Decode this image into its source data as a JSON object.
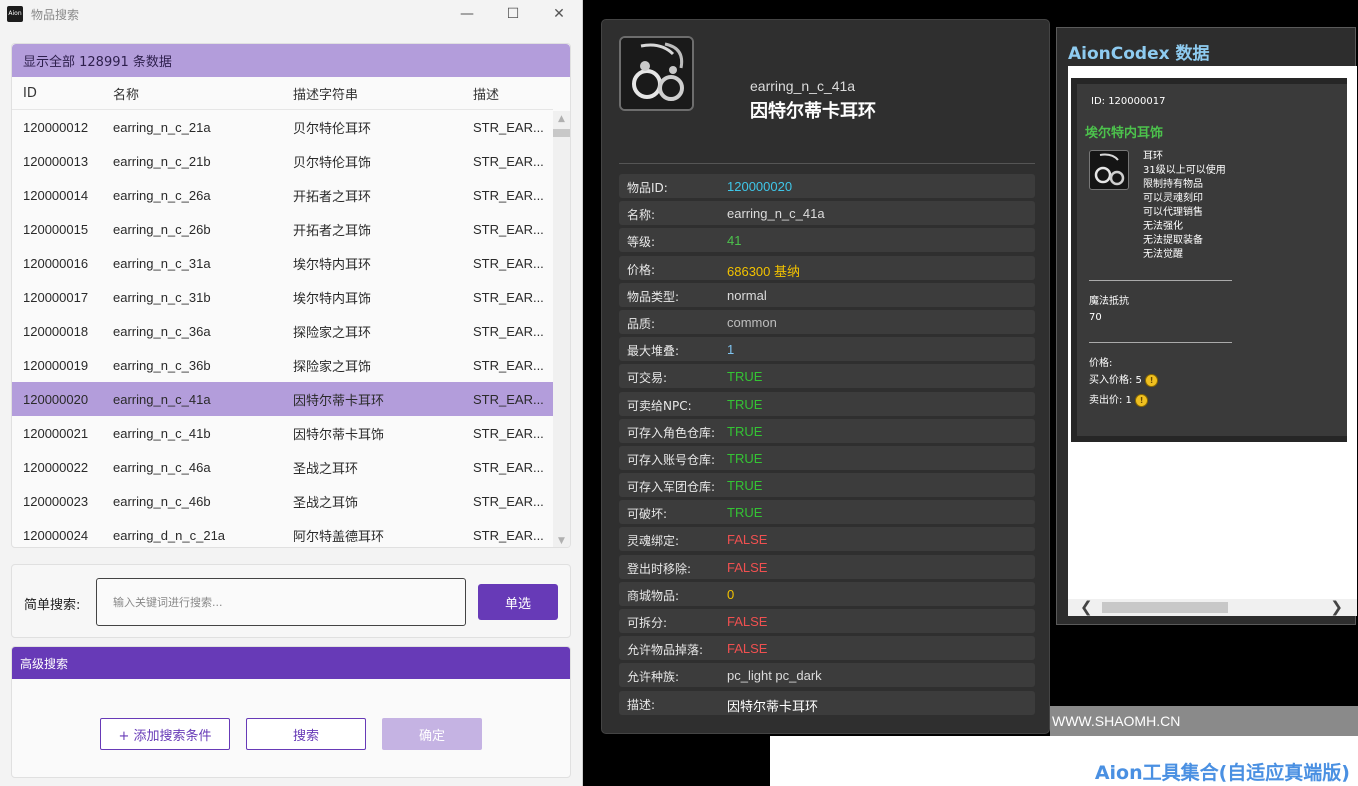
{
  "window": {
    "app_icon_text": "Aion",
    "title": "物品搜索",
    "controls": {
      "minimize": "—",
      "maximize": "☐",
      "close": "✕"
    }
  },
  "table": {
    "banner": "显示全部 128991 条数据",
    "columns": [
      "ID",
      "名称",
      "描述字符串",
      "描述"
    ],
    "rows": [
      {
        "id": "120000012",
        "name": "earring_n_c_21a",
        "desc": "贝尔特伦耳环",
        "str": "STR_EAR..."
      },
      {
        "id": "120000013",
        "name": "earring_n_c_21b",
        "desc": "贝尔特伦耳饰",
        "str": "STR_EAR..."
      },
      {
        "id": "120000014",
        "name": "earring_n_c_26a",
        "desc": "开拓者之耳环",
        "str": "STR_EAR..."
      },
      {
        "id": "120000015",
        "name": "earring_n_c_26b",
        "desc": "开拓者之耳饰",
        "str": "STR_EAR..."
      },
      {
        "id": "120000016",
        "name": "earring_n_c_31a",
        "desc": "埃尔特内耳环",
        "str": "STR_EAR..."
      },
      {
        "id": "120000017",
        "name": "earring_n_c_31b",
        "desc": "埃尔特内耳饰",
        "str": "STR_EAR..."
      },
      {
        "id": "120000018",
        "name": "earring_n_c_36a",
        "desc": "探险家之耳环",
        "str": "STR_EAR..."
      },
      {
        "id": "120000019",
        "name": "earring_n_c_36b",
        "desc": "探险家之耳饰",
        "str": "STR_EAR..."
      },
      {
        "id": "120000020",
        "name": "earring_n_c_41a",
        "desc": "因特尔蒂卡耳环",
        "str": "STR_EAR...",
        "selected": true
      },
      {
        "id": "120000021",
        "name": "earring_n_c_41b",
        "desc": "因特尔蒂卡耳饰",
        "str": "STR_EAR..."
      },
      {
        "id": "120000022",
        "name": "earring_n_c_46a",
        "desc": "圣战之耳环",
        "str": "STR_EAR..."
      },
      {
        "id": "120000023",
        "name": "earring_n_c_46b",
        "desc": "圣战之耳饰",
        "str": "STR_EAR..."
      },
      {
        "id": "120000024",
        "name": "earring_d_n_c_21a",
        "desc": "阿尔特盖德耳环",
        "str": "STR_EAR..."
      }
    ],
    "selected_row_color": "#b39ddb"
  },
  "simple_search": {
    "label": "简单搜索:",
    "placeholder": "输入关键词进行搜索...",
    "button": "单选"
  },
  "advanced_search": {
    "header": "高级搜索",
    "add_button": "+ 添加搜索条件",
    "search_button": "搜索",
    "confirm_button": "确定"
  },
  "detail": {
    "code": "earring_n_c_41a",
    "title": "因特尔蒂卡耳环",
    "properties": [
      {
        "key": "物品ID:",
        "value": "120000020",
        "color": "#3fc6e8"
      },
      {
        "key": "名称:",
        "value": "earring_n_c_41a",
        "color": "#dcdcdc"
      },
      {
        "key": "等级:",
        "value": "41",
        "color": "#4cc24c"
      },
      {
        "key": "价格:",
        "value": "686300 基纳",
        "color": "#f2c200"
      },
      {
        "key": "物品类型:",
        "value": "normal",
        "color": "#dcdcdc"
      },
      {
        "key": "品质:",
        "value": "common",
        "color": "#bdbdbd"
      },
      {
        "key": "最大堆叠:",
        "value": "1",
        "color": "#7fc4f0"
      },
      {
        "key": "可交易:",
        "value": "TRUE",
        "color": "#34c434"
      },
      {
        "key": "可卖给NPC:",
        "value": "TRUE",
        "color": "#34c434"
      },
      {
        "key": "可存入角色仓库:",
        "value": "TRUE",
        "color": "#34c434"
      },
      {
        "key": "可存入账号仓库:",
        "value": "TRUE",
        "color": "#34c434"
      },
      {
        "key": "可存入军团仓库:",
        "value": "TRUE",
        "color": "#34c434"
      },
      {
        "key": "可破坏:",
        "value": "TRUE",
        "color": "#34c434"
      },
      {
        "key": "灵魂绑定:",
        "value": "FALSE",
        "color": "#f05050"
      },
      {
        "key": "登出时移除:",
        "value": "FALSE",
        "color": "#f05050"
      },
      {
        "key": "商城物品:",
        "value": "0",
        "color": "#f2c200"
      },
      {
        "key": "可拆分:",
        "value": "FALSE",
        "color": "#f05050"
      },
      {
        "key": "允许物品掉落:",
        "value": "FALSE",
        "color": "#f05050"
      },
      {
        "key": "允许种族:",
        "value": "pc_light pc_dark",
        "color": "#dcdcdc"
      },
      {
        "key": "描述:",
        "value": "因特尔蒂卡耳环",
        "color": "#ffffff"
      }
    ]
  },
  "codex": {
    "title": "AionCodex 数据",
    "id_line": "ID: 120000017",
    "item_name": "埃尔特内耳饰",
    "lines": [
      "耳环",
      "31级以上可以使用",
      "限制持有物品",
      "可以灵魂刻印",
      "可以代理销售",
      "无法强化",
      "无法提取装备",
      "无法觉醒"
    ],
    "stat_name": "魔法抵抗",
    "stat_value": "70",
    "price_label": "价格:",
    "buy_price": "买入价格: 5",
    "sell_price": "卖出价: 1"
  },
  "watermark": {
    "site": "WWW.SHAOMH.CN",
    "brand": "Aion工具集合(自适应真端版)"
  }
}
